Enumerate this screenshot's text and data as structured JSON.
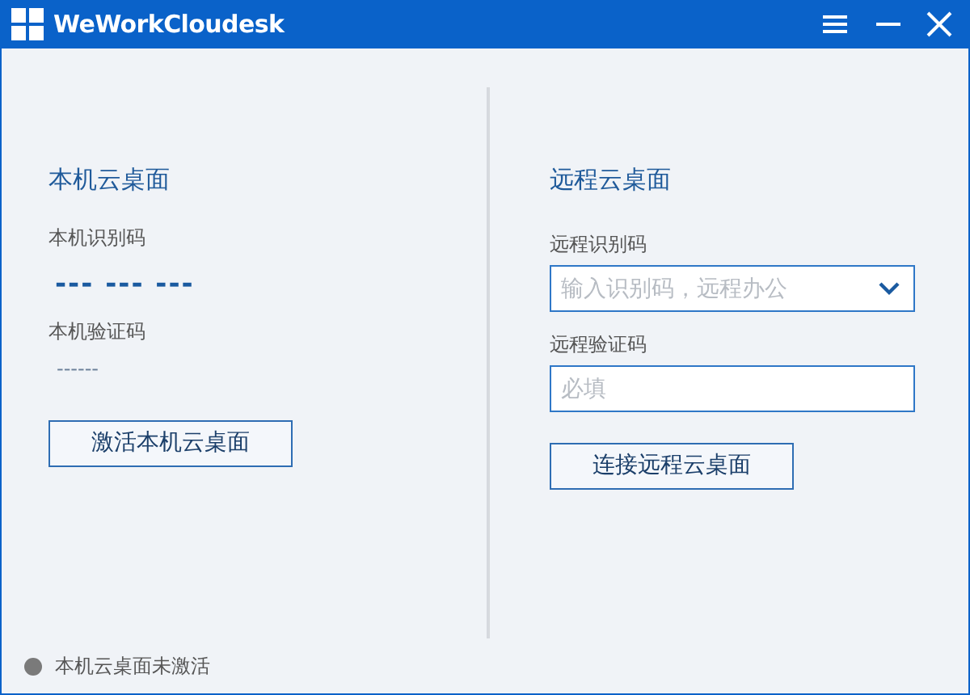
{
  "window": {
    "title": "WeWorkCloudesk"
  },
  "local": {
    "title": "本机云桌面",
    "id_label": "本机识别码",
    "id_value": "--- --- ---",
    "code_label": "本机验证码",
    "code_value": "------",
    "button": "激活本机云桌面"
  },
  "remote": {
    "title": "远程云桌面",
    "id_label": "远程识别码",
    "id_placeholder": "输入识别码，远程办公",
    "code_label": "远程验证码",
    "code_placeholder": "必填",
    "button": "连接远程云桌面"
  },
  "status_bar": {
    "text": "本机云桌面未激活",
    "activated": false
  }
}
